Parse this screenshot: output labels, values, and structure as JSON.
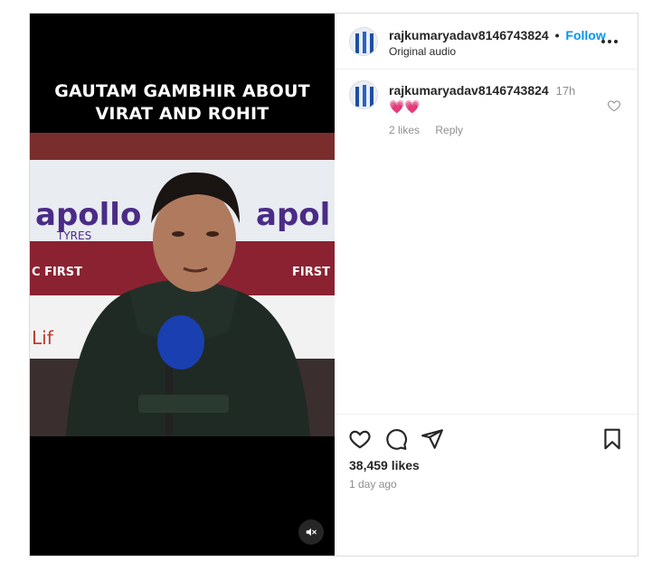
{
  "video": {
    "title_lines": [
      "GAUTAM GAMBHIR ABOUT",
      "VIRAT AND ROHIT"
    ],
    "mute_icon": "speaker-muted-icon"
  },
  "header": {
    "username": "rajkumaryadav8146743824",
    "separator": "•",
    "follow_label": "Follow",
    "audio_label": "Original audio",
    "more_icon": "more-options-icon"
  },
  "comment": {
    "username": "rajkumaryadav8146743824",
    "time": "17h",
    "text": "💗💗",
    "likes": "2 likes",
    "reply_label": "Reply"
  },
  "actions": {
    "likes": "38,459 likes",
    "age": "1 day ago"
  },
  "colors": {
    "follow": "#0095f6",
    "secondary_text": "#8e8e8e",
    "heart": "#ff3e7a"
  }
}
